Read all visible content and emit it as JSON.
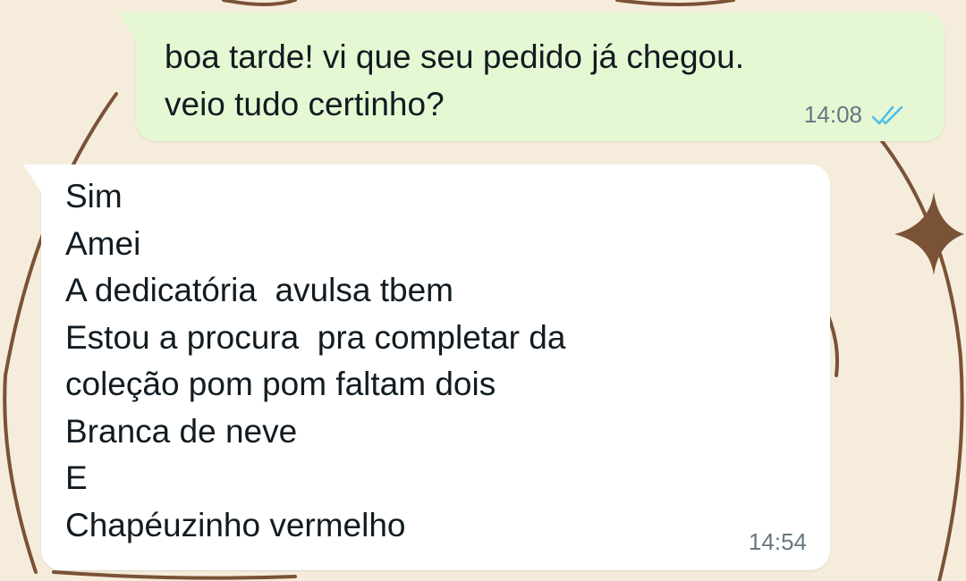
{
  "messages": [
    {
      "direction": "outgoing",
      "lines": [
        "boa tarde! vi que seu pedido já chegou.",
        "veio tudo certinho?"
      ],
      "time": "14:08",
      "status": "read",
      "status_icon": "double-check-icon",
      "bubble_color": "#e5f8d3",
      "status_color": "#53bdeb"
    },
    {
      "direction": "incoming",
      "lines": [
        "Sim",
        "Amei",
        "A dedicatória  avulsa tbem",
        "Estou a procura  pra completar da",
        "coleção pom pom faltam dois",
        "Branca de neve",
        "E",
        "Chapéuzinho vermelho"
      ],
      "time": "14:54",
      "bubble_color": "#ffffff"
    }
  ],
  "wallpaper": {
    "background_color": "#f6ecdc",
    "doodle_color": "#7a5235",
    "doodles": [
      "arc-doodle",
      "sparkle-star-icon"
    ]
  }
}
